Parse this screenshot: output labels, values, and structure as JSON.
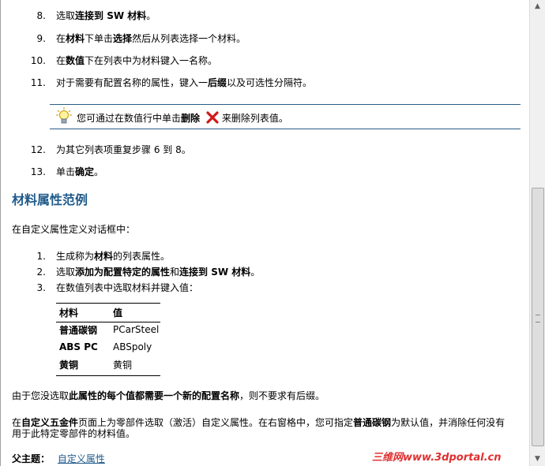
{
  "steps_top": [
    {
      "num": "8.",
      "a": "选取",
      "b": "连接到 SW 材料",
      "c": "。"
    },
    {
      "num": "9.",
      "a": "在",
      "b": "材料",
      "c": "下单击",
      "d": "选择",
      "e": "然后从列表选择一个材料。"
    },
    {
      "num": "10.",
      "a": "在",
      "b": "数值",
      "c": "下在列表中为材料键入一名称。"
    },
    {
      "num": "11.",
      "a": "对于需要有配置名称的属性，键入一",
      "b": "后缀",
      "c": "以及可选性分隔符。"
    }
  ],
  "tip": {
    "a": "您可通过在数值行中单击",
    "b": "删除",
    "c": "来删除列表值。"
  },
  "steps_more": [
    {
      "num": "12.",
      "a": "为其它列表项重复步骤 6 到 8。"
    },
    {
      "num": "13.",
      "a": "单击",
      "b": "确定",
      "c": "。"
    }
  ],
  "section_title": "材料属性范例",
  "intro": "在自定义属性定义对话框中：",
  "example_steps": [
    {
      "num": "1.",
      "a": "生成称为",
      "b": "材料",
      "c": "的列表属性。"
    },
    {
      "num": "2.",
      "a": "选取",
      "b": "添加为配置特定的属性",
      "c": "和",
      "d": "连接到 SW 材料",
      "e": "。"
    },
    {
      "num": "3.",
      "a": "在数值列表中选取材料并键入值："
    }
  ],
  "table": {
    "headers": [
      "材料",
      "值"
    ],
    "rows": [
      [
        "普通碳钢",
        "PCarSteel"
      ],
      [
        "ABS PC",
        "ABSpoly"
      ],
      [
        "黄铜",
        "黄铜"
      ]
    ]
  },
  "note": {
    "a": "由于您没选取",
    "b": "此属性的每个值都需要一个新的配置名称",
    "c": "，则不要求有后缀。"
  },
  "para": {
    "a": "在",
    "b": "自定义五金件",
    "c": "页面上为零部件选取（激活）自定义属性。在右窗格中，您可指定",
    "d": "普通碳钢",
    "e": "为默认值，并消除任何没有",
    "line2": "用于此特定零部件的材料值。"
  },
  "parent": {
    "label": "父主题：",
    "link": "自定义属性"
  },
  "watermark": "三维网www.3dportal.cn",
  "icons": {
    "tip": "lightbulb-icon",
    "delete": "red-x-icon"
  }
}
